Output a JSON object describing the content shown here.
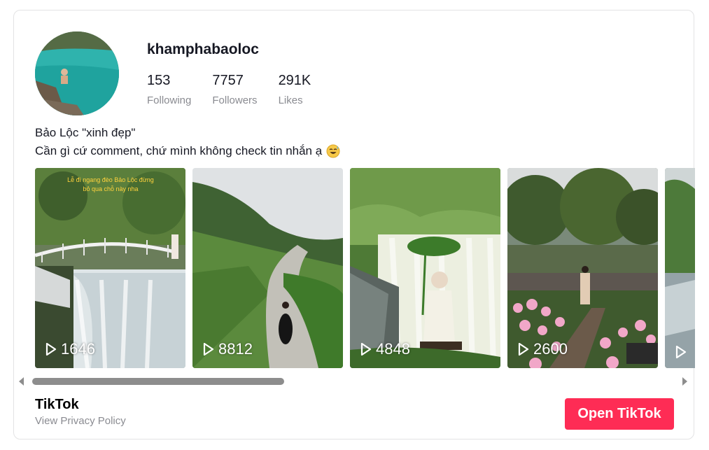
{
  "profile": {
    "username": "khamphabaoloc",
    "stats": [
      {
        "value": "153",
        "label": "Following"
      },
      {
        "value": "7757",
        "label": "Followers"
      },
      {
        "value": "291K",
        "label": "Likes"
      }
    ],
    "bio_line1": "Bảo Lộc \"xinh đẹp\"",
    "bio_line2": "Cần gì cứ comment, chứ mình không check tin nhắn ạ",
    "bio_emoji": "sweat-smile-emoji"
  },
  "videos": [
    {
      "views": "1646",
      "overlay_text": "Lễ đi ngang đèo Bảo Lộc đừng bỏ qua chỗ này nha"
    },
    {
      "views": "8812"
    },
    {
      "views": "4848"
    },
    {
      "views": "2600"
    },
    {
      "views": ""
    }
  ],
  "footer": {
    "brand": "TikTok",
    "privacy": "View Privacy Policy",
    "open_button": "Open TikTok"
  },
  "colors": {
    "accent": "#fe2c55",
    "muted": "#8a8b91",
    "text": "#161823"
  }
}
